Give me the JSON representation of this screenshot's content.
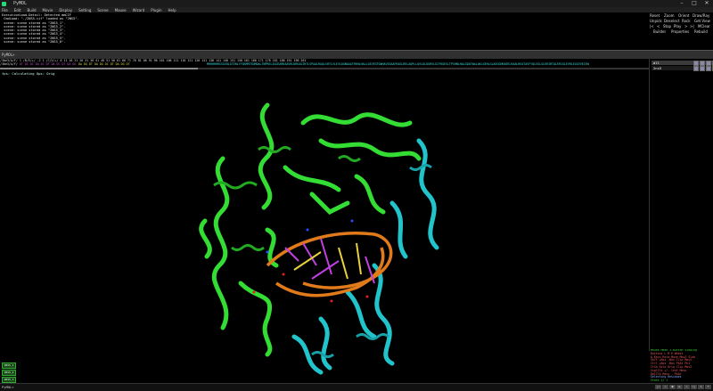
{
  "window": {
    "title": "PyMOL",
    "controls": [
      "–",
      "□",
      "✕"
    ]
  },
  "menu": [
    "File",
    "Edit",
    "Build",
    "Movie",
    "Display",
    "Setting",
    "Scene",
    "Mouse",
    "Wizard",
    "Plugin",
    "Help"
  ],
  "console_lines": [
    "ExecutiveLoad-Detail: Detected mmCIF",
    " CmdLoad: \"./2NS5.cif\" loaded as \"2NS5\".",
    " scene: scene stored as \"2NS5_1\".",
    " scene: scene stored as \"2NS5_2\".",
    " scene: scene stored as \"2NS5_3\".",
    " scene: scene stored as \"2NS5_4\".",
    " scene: scene stored as \"2NS5_5\".",
    " scene: scene stored as \"2NS5_6\"."
  ],
  "control_buttons": [
    [
      "Reset",
      "Zoom",
      "Orient",
      "Draw/Ray"
    ],
    [
      "Unpick",
      "Deselect",
      "Rock",
      "Get View"
    ],
    [
      "|<",
      "<",
      "Stop",
      "Play",
      ">",
      ">|",
      "MClear"
    ],
    [
      "Builder",
      "Properties",
      "Rebuild"
    ]
  ],
  "command_prompt": "PyMOL>",
  "sequence": {
    "numbers": "/3be3/A/F/        1              /B/E/+/  -2    1           /C/V/+/    6    11    16    21    26    31    36    41    46    51    56    61    66    71    76    81    86    91    96   101   106   111   116   121   126   131   136   141   146   151   156   161   166   171   176   181   186   191   196   201",
    "row1_label": "/3be3/A/F/",
    "row1_seq": " DT DC DC DA DC DT DA DC DT DA DG",
    "row2_label": "",
    "row2_seq": "          DA DG DT DA DG DC DT DA DG DT",
    "row3_label": "",
    "row3_seq": "MHHHHHHSSGVDLGTENLYFQSMRTEDMDALTNPRELIGGEAMEAAVRLDREAGIRTLSPAALRAQLSHTLVLEVLDGNAAATRRHLHALLGEVEGTGWHAVSEAAFRAGLRELAQPLLQVLDLDGRVLGIYRGESLTPSHNLHALGDATWALAKLGEHLGLAEGGHRAEELRAALREATAVFYQLEGLGLERIRTALERIGLEVRLEGGVVEIEW"
  },
  "status_text": "fps: Calculating  Ops: Orig",
  "objects": [
    {
      "name": "all",
      "selected": true
    },
    {
      "name": "2ns5",
      "selected": false
    }
  ],
  "object_button_colors": [
    "#8a8aa8",
    "#8a8aa8",
    "#8a8aa8",
    "#c0a030",
    "#c050c0"
  ],
  "mouse_help": {
    "title": "Mouse Mode 3-Button Viewing",
    "lines": [
      "Buttons  L    M    R   Wheel",
      " & Keys Rota Move MovZ Slab",
      "  Shft  +Box -Box Clip MovS",
      "  Ctrl  +Box -Box  PkAt Pk1",
      "  CtSh  Sele Orig Clip MovZ",
      "SnglClk +/-  Cent Menu",
      "DblClk  Menu   -  PkAt",
      "Selecting Residues",
      "State    1/  1"
    ]
  },
  "scene_buttons": [
    "2NS5_1",
    "2NS5_2",
    "2NS5_3"
  ],
  "vcr_buttons": [
    "|<",
    "<",
    "■",
    "▶",
    ">",
    ">|",
    "S",
    "F"
  ],
  "colors": {
    "protein_green": "#33dd33",
    "protein_cyan": "#22c4cc",
    "dna_backbone": "#e07a1a",
    "ligand_magenta": "#c040e0",
    "ligand_yellow": "#e8d040",
    "atom_red": "#e02020",
    "atom_blue": "#2050ff"
  }
}
